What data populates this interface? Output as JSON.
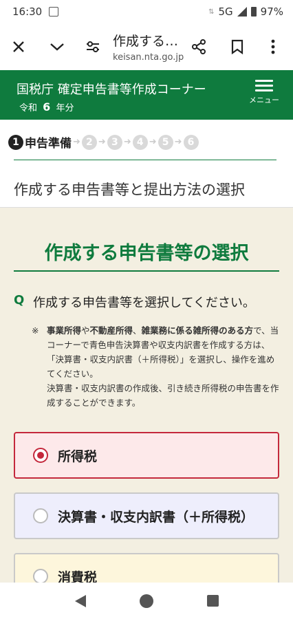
{
  "status": {
    "time": "16:30",
    "network": "5G",
    "battery": "97%"
  },
  "browser": {
    "title": "作成する…",
    "domain": "keisan.nta.go.jp"
  },
  "header": {
    "title": "国税庁 確定申告書等作成コーナー",
    "era": "令和",
    "year": "6",
    "year_suffix": "年分",
    "menu_label": "メニュー"
  },
  "steps": {
    "current_number": "1",
    "current_label": "申告準備",
    "others": [
      "2",
      "3",
      "4",
      "5",
      "6"
    ],
    "heading": "作成する申告書等と提出方法の選択"
  },
  "main": {
    "heading": "作成する申告書等の選択",
    "question_mark": "Q",
    "question": "作成する申告書等を選択してください。",
    "note": {
      "asterisk": "※",
      "b1": "事業所得",
      "t1": "や",
      "b2": "不動産所得",
      "t2": "、",
      "b3": "雑業務に係る雑所得のある方",
      "t3": "で、当コーナーで青色申告決算書や収支内訳書を作成する方は、「決算書・収支内訳書（＋所得税）」を選択し、操作を進めてください。",
      "line2": "決算書・収支内訳書の作成後、引き続き所得税の申告書を作成することができます。"
    },
    "options": [
      {
        "label": "所得税",
        "selected": true
      },
      {
        "label": "決算書・収支内訳書（＋所得税）",
        "selected": false
      },
      {
        "label": "消費税",
        "selected": false
      }
    ]
  },
  "colors": {
    "brand_green": "#0f7b3e",
    "selected_red": "#c4283c"
  }
}
